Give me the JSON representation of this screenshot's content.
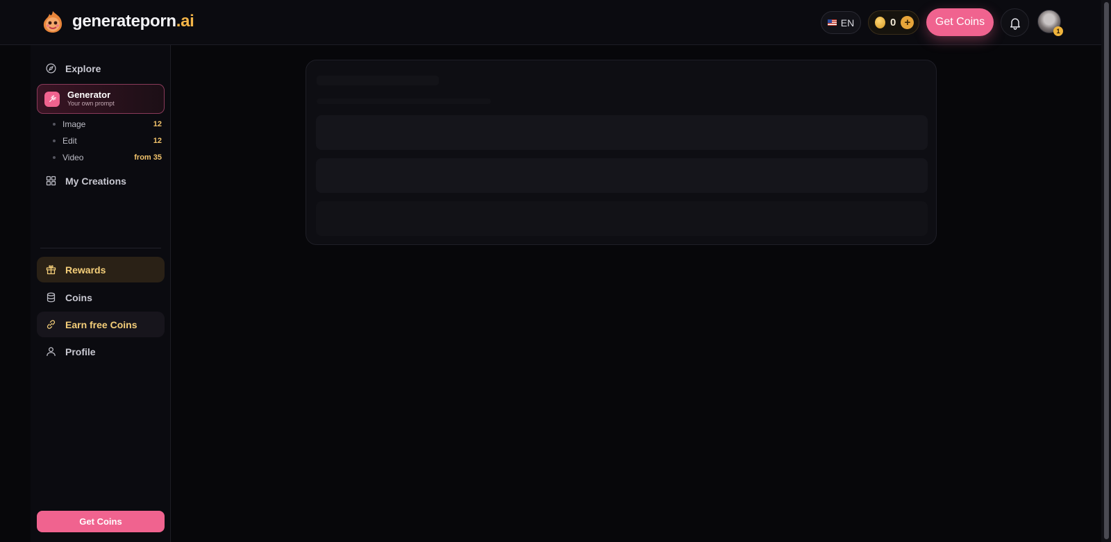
{
  "header": {
    "brand_name": "generateporn",
    "brand_tld": ".ai",
    "language": "EN",
    "coin_balance": "0",
    "coin_plus": "+",
    "get_coins_label": "Get Coins",
    "notification_badge": "1"
  },
  "sidebar": {
    "explore": "Explore",
    "generator": {
      "title": "Generator",
      "subtitle": "Your own prompt"
    },
    "generator_items": [
      {
        "label": "Image",
        "count": "12"
      },
      {
        "label": "Edit",
        "count": "12"
      },
      {
        "label": "Video",
        "count": "from 35"
      }
    ],
    "my_creations": "My Creations",
    "rewards": "Rewards",
    "coins": "Coins",
    "earn_free_coins": "Earn free Coins",
    "profile": "Profile",
    "get_coins_label": "Get Coins"
  },
  "colors": {
    "accent_pink": "#f0638f",
    "accent_gold": "#f5cf7a",
    "background": "#07070a"
  },
  "icons": {
    "logo": "flame-mascot-logo",
    "explore": "compass-icon",
    "generator": "magic-wand-icon",
    "my_creations": "grid-icon",
    "rewards": "gift-icon",
    "coins": "coin-stack-icon",
    "earn": "link-icon",
    "profile": "user-icon",
    "notifications": "bell-icon"
  }
}
